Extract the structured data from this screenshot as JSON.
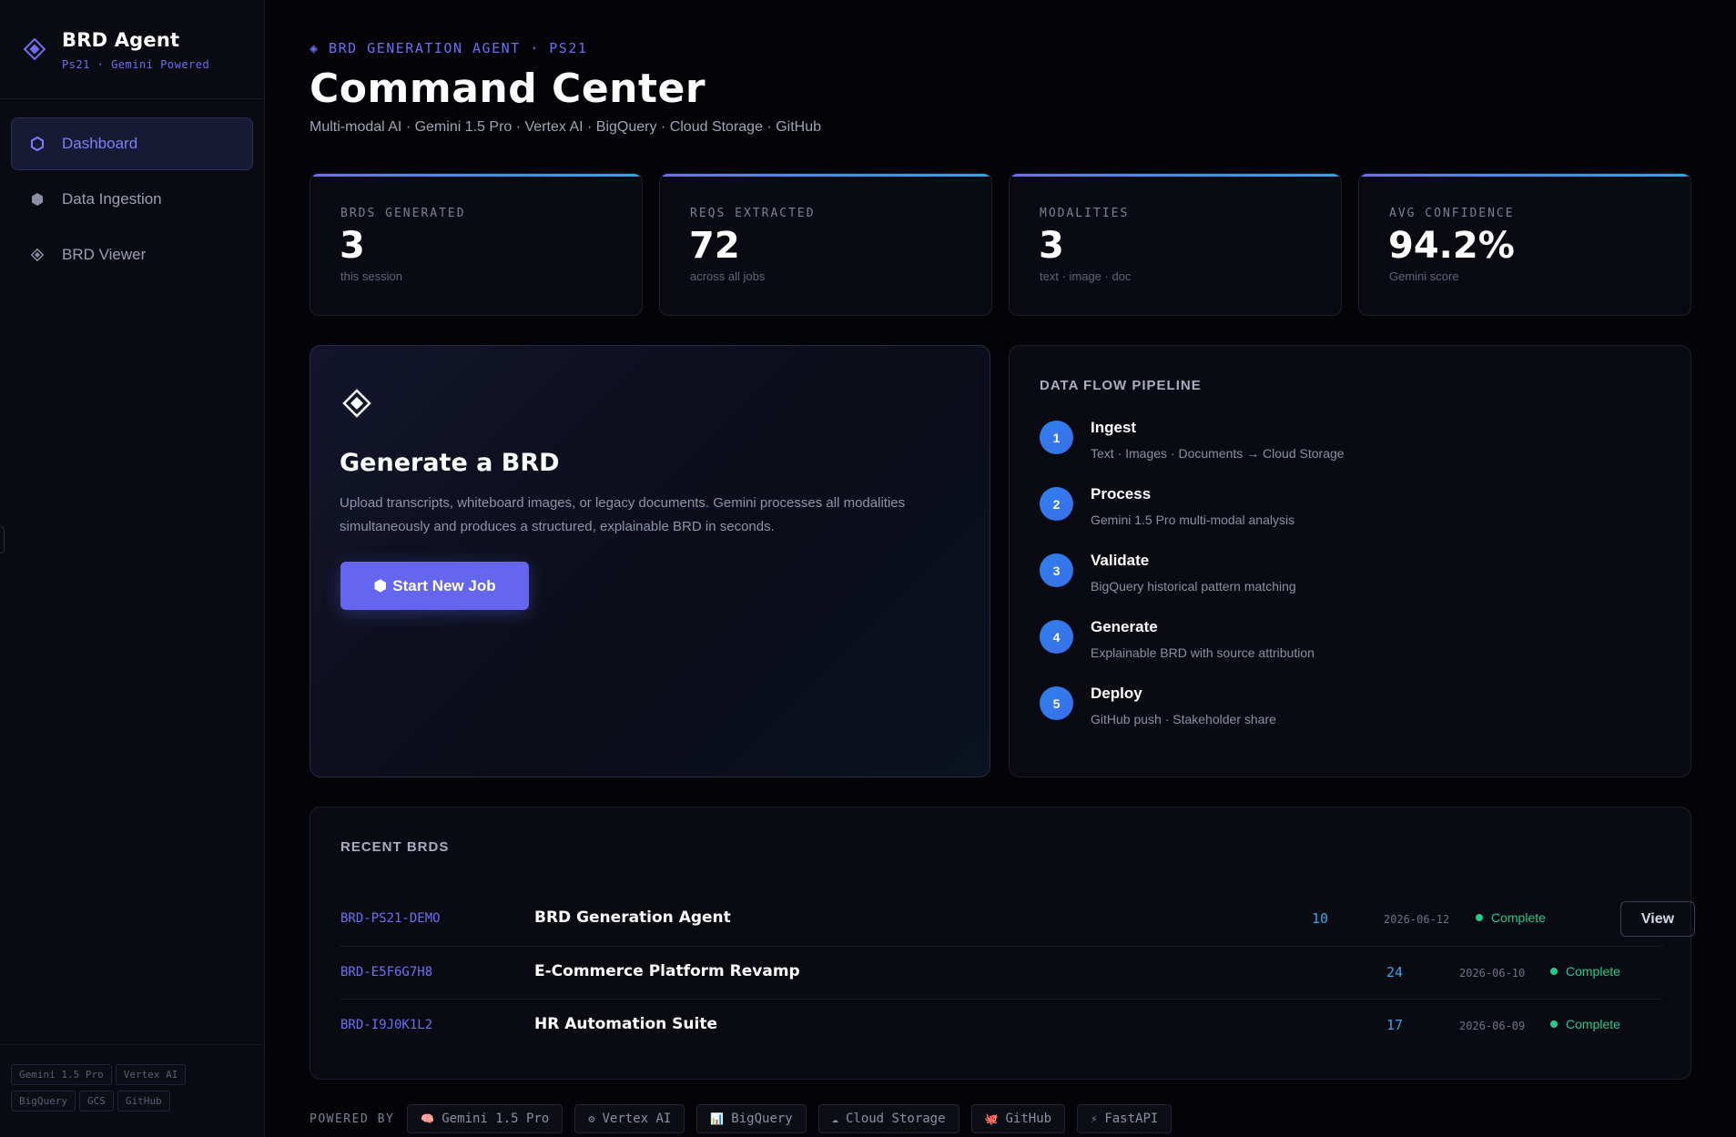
{
  "brand": {
    "title": "BRD Agent",
    "subtitle": "Ps21 · Gemini Powered",
    "accent": "#6d6ef5"
  },
  "sidebar": {
    "items": [
      {
        "label": "Dashboard",
        "icon": "hexagon-outline-icon",
        "active": true
      },
      {
        "label": "Data Ingestion",
        "icon": "hexagon-filled-icon",
        "active": false
      },
      {
        "label": "BRD Viewer",
        "icon": "diamond-icon",
        "active": false
      }
    ],
    "tags": [
      "Gemini 1.5 Pro",
      "Vertex AI",
      "BigQuery",
      "GCS",
      "GitHub"
    ]
  },
  "header": {
    "eyebrow": "◈ BRD GENERATION AGENT · PS21",
    "title": "Command Center",
    "subtitle": "Multi-modal AI · Gemini 1.5 Pro · Vertex AI · BigQuery · Cloud Storage · GitHub"
  },
  "stats": [
    {
      "label": "BRDS GENERATED",
      "value": "3",
      "hint": "this session"
    },
    {
      "label": "REQS EXTRACTED",
      "value": "72",
      "hint": "across all jobs"
    },
    {
      "label": "MODALITIES",
      "value": "3",
      "hint": "text · image · doc"
    },
    {
      "label": "AVG CONFIDENCE",
      "value": "94.2%",
      "hint": "Gemini score"
    }
  ],
  "generate": {
    "title": "Generate a BRD",
    "description": "Upload transcripts, whiteboard images, or legacy documents. Gemini processes all modalities simultaneously and produces a structured, explainable BRD in seconds.",
    "button_icon": "⬢",
    "button_label": "Start New Job"
  },
  "pipeline": {
    "title": "DATA FLOW PIPELINE",
    "steps": [
      {
        "num": "1",
        "name": "Ingest",
        "desc": "Text · Images · Documents → Cloud Storage"
      },
      {
        "num": "2",
        "name": "Process",
        "desc": "Gemini 1.5 Pro multi-modal analysis"
      },
      {
        "num": "3",
        "name": "Validate",
        "desc": "BigQuery historical pattern matching"
      },
      {
        "num": "4",
        "name": "Generate",
        "desc": "Explainable BRD with source attribution"
      },
      {
        "num": "5",
        "name": "Deploy",
        "desc": "GitHub push · Stakeholder share"
      }
    ]
  },
  "recent": {
    "title": "RECENT BRDS",
    "view_label": "View",
    "rows": [
      {
        "id": "BRD-PS21-DEMO",
        "name": "BRD Generation Agent",
        "count": "10",
        "date": "2026-06-12",
        "status": "Complete"
      },
      {
        "id": "BRD-E5F6G7H8",
        "name": "E-Commerce Platform Revamp",
        "count": "24",
        "date": "2026-06-10",
        "status": "Complete"
      },
      {
        "id": "BRD-I9J0K1L2",
        "name": "HR Automation Suite",
        "count": "17",
        "date": "2026-06-09",
        "status": "Complete"
      }
    ]
  },
  "powered": {
    "label": "POWERED BY",
    "chips": [
      {
        "icon": "🧠",
        "label": "Gemini 1.5 Pro"
      },
      {
        "icon": "⚙",
        "label": "Vertex AI"
      },
      {
        "icon": "📊",
        "label": "BigQuery"
      },
      {
        "icon": "☁",
        "label": "Cloud Storage"
      },
      {
        "icon": "🐙",
        "label": "GitHub"
      },
      {
        "icon": "⚡",
        "label": "FastAPI"
      }
    ]
  }
}
